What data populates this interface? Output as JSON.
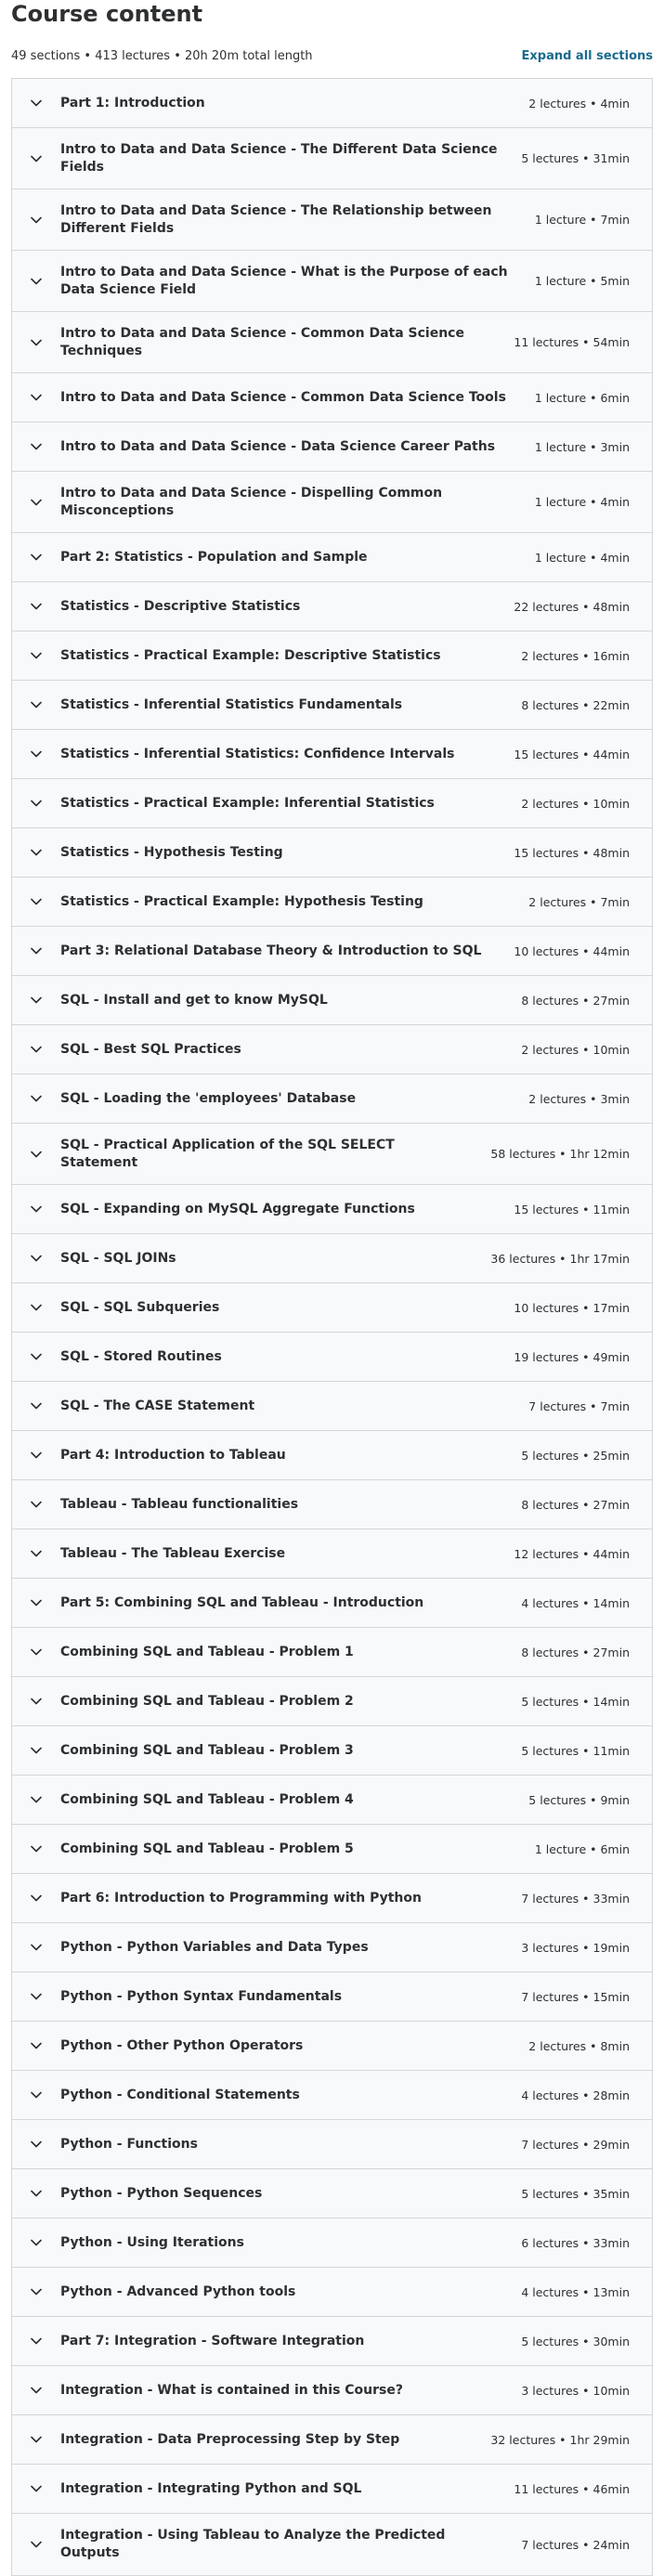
{
  "header": {
    "title": "Course content",
    "summary": "49 sections • 413 lectures • 20h 20m total length",
    "expand_label": "Expand all sections"
  },
  "icons": {
    "section_toggle": "chevron-down-icon"
  },
  "sections": [
    {
      "title": "Part 1: Introduction",
      "info": "2 lectures • 4min"
    },
    {
      "title": "Intro to Data and Data Science - The Different Data Science Fields",
      "info": "5 lectures • 31min"
    },
    {
      "title": "Intro to Data and Data Science - The Relationship between Different Fields",
      "info": "1 lecture • 7min"
    },
    {
      "title": "Intro to Data and Data Science - What is the Purpose of each Data Science Field",
      "info": "1 lecture • 5min"
    },
    {
      "title": "Intro to Data and Data Science - Common Data Science Techniques",
      "info": "11 lectures • 54min"
    },
    {
      "title": "Intro to Data and Data Science - Common Data Science Tools",
      "info": "1 lecture • 6min"
    },
    {
      "title": "Intro to Data and Data Science - Data Science Career Paths",
      "info": "1 lecture • 3min"
    },
    {
      "title": "Intro to Data and Data Science - Dispelling Common Misconceptions",
      "info": "1 lecture • 4min"
    },
    {
      "title": "Part 2: Statistics - Population and Sample",
      "info": "1 lecture • 4min"
    },
    {
      "title": "Statistics - Descriptive Statistics",
      "info": "22 lectures • 48min"
    },
    {
      "title": "Statistics - Practical Example: Descriptive Statistics",
      "info": "2 lectures • 16min"
    },
    {
      "title": "Statistics - Inferential Statistics Fundamentals",
      "info": "8 lectures • 22min"
    },
    {
      "title": "Statistics - Inferential Statistics: Confidence Intervals",
      "info": "15 lectures • 44min"
    },
    {
      "title": "Statistics - Practical Example: Inferential Statistics",
      "info": "2 lectures • 10min"
    },
    {
      "title": "Statistics - Hypothesis Testing",
      "info": "15 lectures • 48min"
    },
    {
      "title": "Statistics - Practical Example: Hypothesis Testing",
      "info": "2 lectures • 7min"
    },
    {
      "title": "Part 3: Relational Database Theory & Introduction to SQL",
      "info": "10 lectures • 44min"
    },
    {
      "title": "SQL - Install and get to know MySQL",
      "info": "8 lectures • 27min"
    },
    {
      "title": "SQL - Best SQL Practices",
      "info": "2 lectures • 10min"
    },
    {
      "title": "SQL - Loading the 'employees' Database",
      "info": "2 lectures • 3min"
    },
    {
      "title": "SQL - Practical Application of the SQL SELECT Statement",
      "info": "58 lectures • 1hr 12min"
    },
    {
      "title": "SQL - Expanding on MySQL Aggregate Functions",
      "info": "15 lectures • 11min"
    },
    {
      "title": "SQL - SQL JOINs",
      "info": "36 lectures • 1hr 17min"
    },
    {
      "title": "SQL - SQL Subqueries",
      "info": "10 lectures • 17min"
    },
    {
      "title": "SQL - Stored Routines",
      "info": "19 lectures • 49min"
    },
    {
      "title": "SQL - The CASE Statement",
      "info": "7 lectures • 7min"
    },
    {
      "title": "Part 4: Introduction to Tableau",
      "info": "5 lectures • 25min"
    },
    {
      "title": "Tableau - Tableau functionalities",
      "info": "8 lectures • 27min"
    },
    {
      "title": "Tableau - The Tableau Exercise",
      "info": "12 lectures • 44min"
    },
    {
      "title": "Part 5: Combining SQL and Tableau - Introduction",
      "info": "4 lectures • 14min"
    },
    {
      "title": "Combining SQL and Tableau - Problem 1",
      "info": "8 lectures • 27min"
    },
    {
      "title": "Combining SQL and Tableau - Problem 2",
      "info": "5 lectures • 14min"
    },
    {
      "title": "Combining SQL and Tableau - Problem 3",
      "info": "5 lectures • 11min"
    },
    {
      "title": "Combining SQL and Tableau - Problem 4",
      "info": "5 lectures • 9min"
    },
    {
      "title": "Combining SQL and Tableau - Problem 5",
      "info": "1 lecture • 6min"
    },
    {
      "title": "Part 6: Introduction to Programming with Python",
      "info": "7 lectures • 33min"
    },
    {
      "title": "Python - Python Variables and Data Types",
      "info": "3 lectures • 19min"
    },
    {
      "title": "Python - Python Syntax Fundamentals",
      "info": "7 lectures • 15min"
    },
    {
      "title": "Python - Other Python Operators",
      "info": "2 lectures • 8min"
    },
    {
      "title": "Python - Conditional Statements",
      "info": "4 lectures • 28min"
    },
    {
      "title": "Python - Functions",
      "info": "7 lectures • 29min"
    },
    {
      "title": "Python - Python Sequences",
      "info": "5 lectures • 35min"
    },
    {
      "title": "Python - Using Iterations",
      "info": "6 lectures • 33min"
    },
    {
      "title": "Python - Advanced Python tools",
      "info": "4 lectures • 13min"
    },
    {
      "title": "Part 7: Integration - Software Integration",
      "info": "5 lectures • 30min"
    },
    {
      "title": "Integration - What is contained in this Course?",
      "info": "3 lectures • 10min"
    },
    {
      "title": "Integration - Data Preprocessing Step by Step",
      "info": "32 lectures • 1hr 29min"
    },
    {
      "title": "Integration - Integrating Python and SQL",
      "info": "11 lectures • 46min"
    },
    {
      "title": "Integration - Using Tableau to Analyze the Predicted Outputs",
      "info": "7 lectures • 24min"
    }
  ]
}
